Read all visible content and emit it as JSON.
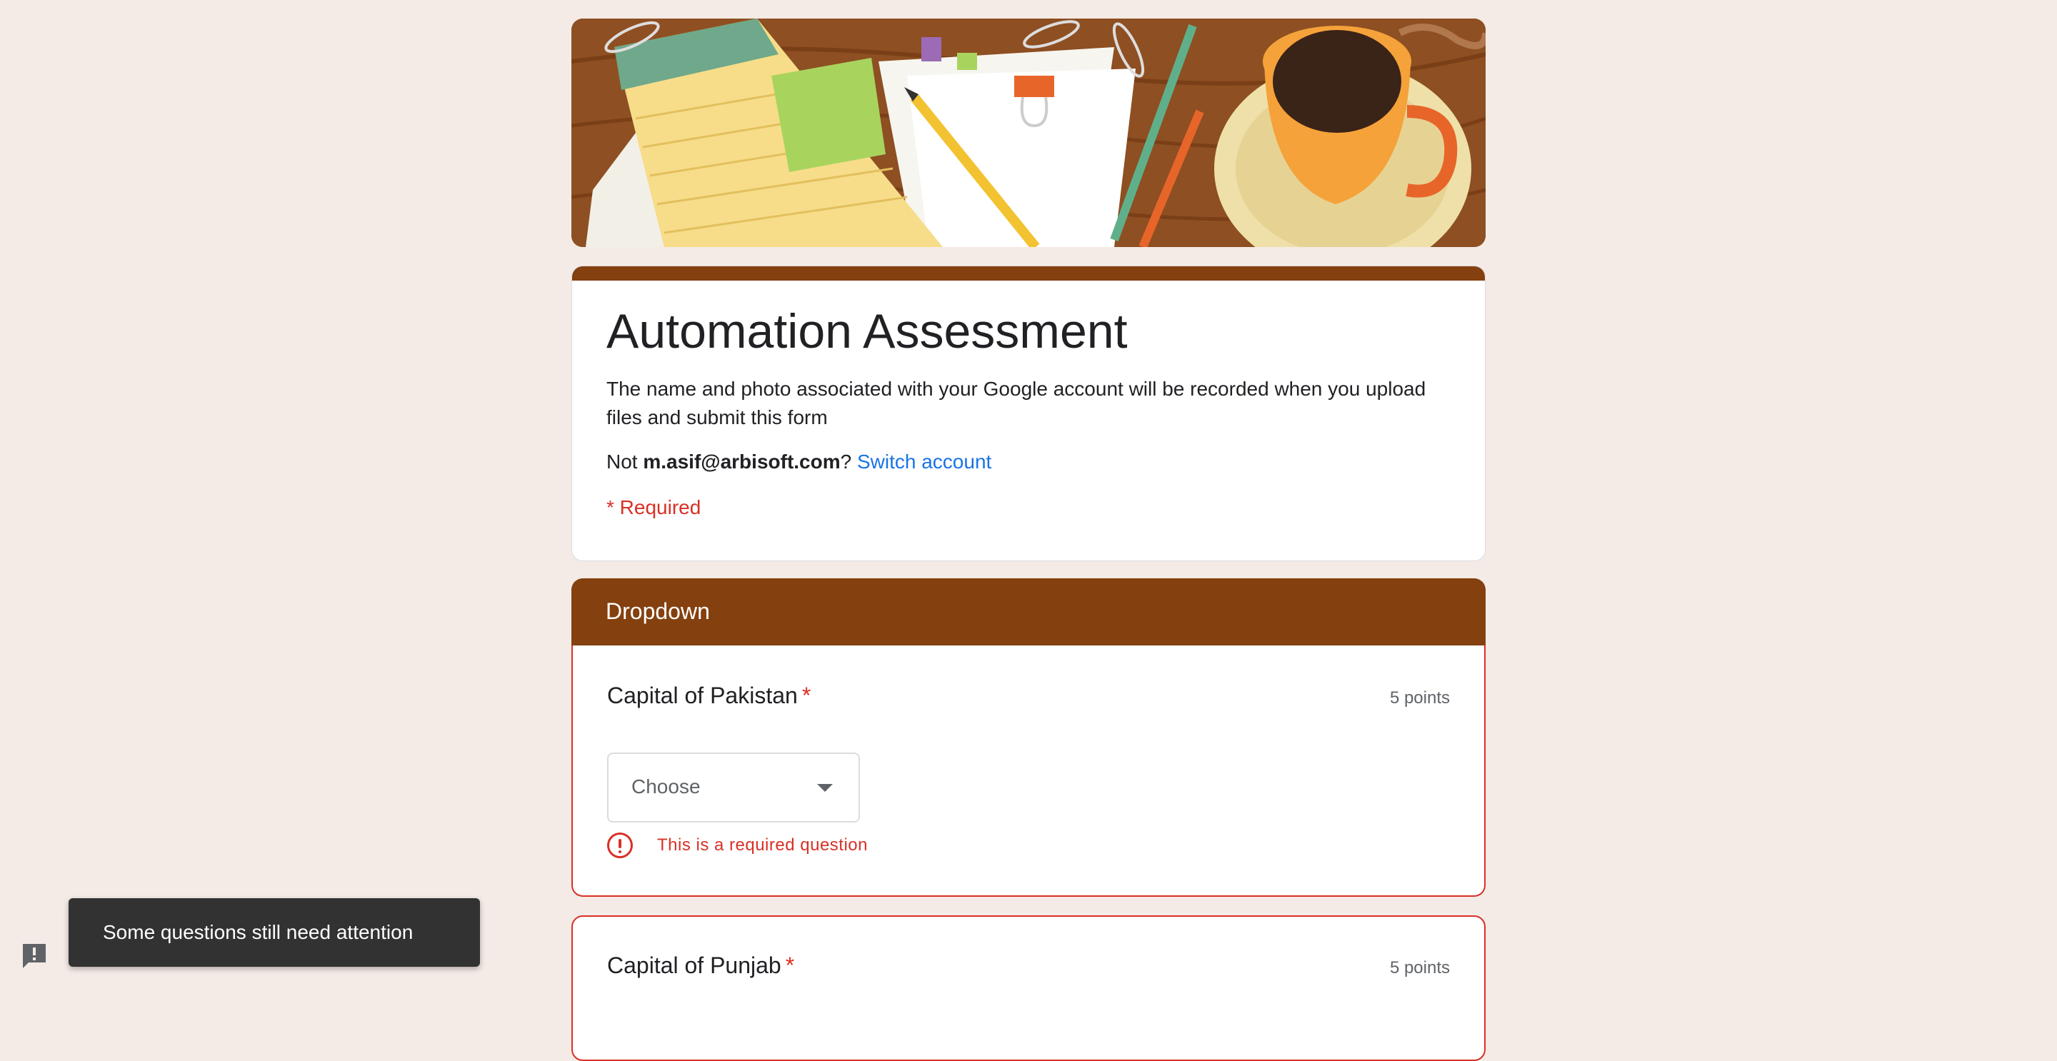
{
  "form": {
    "title": "Automation Assessment",
    "description": "The name and photo associated with your Google account will be recorded when you upload files and submit this form",
    "account_prefix": "Not ",
    "account_email": "m.asif@arbisoft.com",
    "account_suffix": "? ",
    "switch_account": "Switch account",
    "required_note": "* Required",
    "theme_color": "#84400e",
    "error_color": "#d93025",
    "link_color": "#1a73e8"
  },
  "section": {
    "title": "Dropdown"
  },
  "questions": [
    {
      "title": "Capital of Pakistan",
      "required_marker": "*",
      "points": "5 points",
      "placeholder": "Choose",
      "error": "This is a required question"
    },
    {
      "title": "Capital of Punjab",
      "required_marker": "*",
      "points": "5 points"
    }
  ],
  "toast": {
    "message": "Some questions still need attention"
  },
  "icons": {
    "dropdown": "caret-down-icon",
    "error": "error-circle-icon",
    "feedback": "report-feedback-icon"
  }
}
